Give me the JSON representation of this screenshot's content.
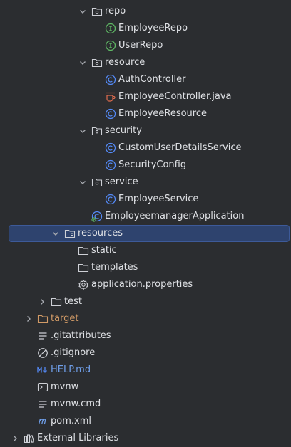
{
  "tree": {
    "pkg_repo": "repo",
    "employee_repo": "EmployeeRepo",
    "user_repo": "UserRepo",
    "pkg_resource": "resource",
    "auth_controller": "AuthController",
    "employee_controller": "EmployeeController.java",
    "employee_resource": "EmployeeResource",
    "pkg_security": "security",
    "custom_user_details_service": "CustomUserDetailsService",
    "security_config": "SecurityConfig",
    "pkg_service": "service",
    "employee_service": "EmployeeService",
    "employeemanager_application": "EmployeemanagerApplication",
    "resources": "resources",
    "static": "static",
    "templates": "templates",
    "application_properties": "application.properties",
    "test": "test",
    "target": "target",
    "gitattributes": ".gitattributes",
    "gitignore": ".gitignore",
    "help_md": "HELP.md",
    "mvnw": "mvnw",
    "mvnw_cmd": "mvnw.cmd",
    "pom_xml": "pom.xml",
    "external_libraries": "External Libraries"
  },
  "colors": {
    "background": "#2b2d30",
    "selection": "#2e436e",
    "text": "#dfe1e5",
    "excluded_folder_text": "#d19a66",
    "modified_file_text": "#6f9ee8",
    "interface_icon": "#5fb865",
    "class_icon": "#548af7"
  }
}
